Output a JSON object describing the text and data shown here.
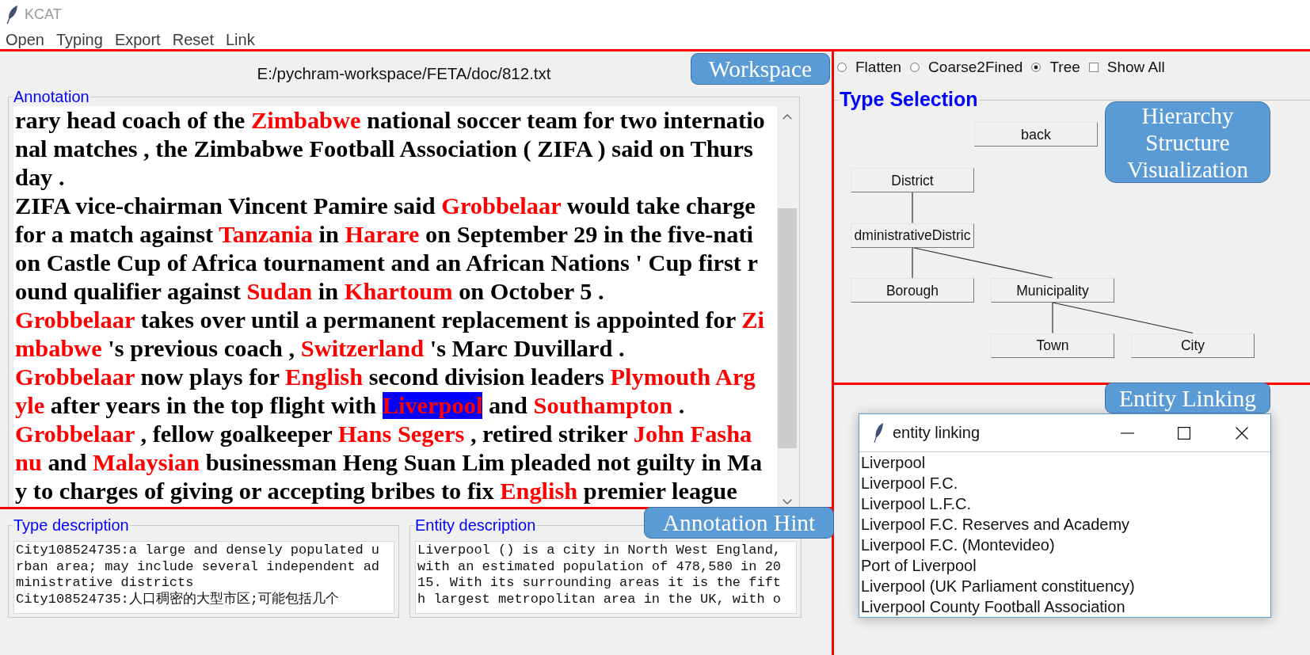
{
  "window": {
    "title": "KCAT"
  },
  "menu": [
    "Open",
    "Typing",
    "Export",
    "Reset",
    "Link"
  ],
  "workspace": {
    "callout": "Workspace",
    "file_path": "E:/pychram-workspace/FETA/doc/812.txt",
    "annotation": {
      "label": "Annotation",
      "lines": [
        {
          "segments": [
            {
              "text": "rary head coach of the ",
              "entity": false,
              "selected": false
            },
            {
              "text": "Zimbabwe",
              "entity": true,
              "selected": false
            },
            {
              "text": " national soccer team for two internatio",
              "entity": false,
              "selected": false
            }
          ]
        },
        {
          "segments": [
            {
              "text": "nal matches , the Zimbabwe Football Association ( ZIFA ) said on Thurs",
              "entity": false,
              "selected": false
            }
          ]
        },
        {
          "segments": [
            {
              "text": "day .",
              "entity": false,
              "selected": false
            }
          ]
        },
        {
          "segments": [
            {
              "text": "ZIFA vice-chairman Vincent Pamire said ",
              "entity": false,
              "selected": false
            },
            {
              "text": "Grobbelaar",
              "entity": true,
              "selected": false
            },
            {
              "text": " would take charge",
              "entity": false,
              "selected": false
            }
          ]
        },
        {
          "segments": [
            {
              "text": "for a match against ",
              "entity": false,
              "selected": false
            },
            {
              "text": "Tanzania",
              "entity": true,
              "selected": false
            },
            {
              "text": " in ",
              "entity": false,
              "selected": false
            },
            {
              "text": "Harare",
              "entity": true,
              "selected": false
            },
            {
              "text": " on September 29 in the five-nati",
              "entity": false,
              "selected": false
            }
          ]
        },
        {
          "segments": [
            {
              "text": "on Castle Cup of Africa tournament and an African Nations ' Cup first r",
              "entity": false,
              "selected": false
            }
          ]
        },
        {
          "segments": [
            {
              "text": "ound qualifier against ",
              "entity": false,
              "selected": false
            },
            {
              "text": "Sudan",
              "entity": true,
              "selected": false
            },
            {
              "text": " in ",
              "entity": false,
              "selected": false
            },
            {
              "text": "Khartoum",
              "entity": true,
              "selected": false
            },
            {
              "text": " on October 5 .",
              "entity": false,
              "selected": false
            }
          ]
        },
        {
          "segments": [
            {
              "text": "Grobbelaar",
              "entity": true,
              "selected": false
            },
            {
              "text": " takes over until a permanent replacement is appointed for ",
              "entity": false,
              "selected": false
            },
            {
              "text": "Zi",
              "entity": true,
              "selected": false
            }
          ]
        },
        {
          "segments": [
            {
              "text": "mbabwe",
              "entity": true,
              "selected": false
            },
            {
              "text": " 's previous coach , ",
              "entity": false,
              "selected": false
            },
            {
              "text": "Switzerland",
              "entity": true,
              "selected": false
            },
            {
              "text": " 's Marc Duvillard .",
              "entity": false,
              "selected": false
            }
          ]
        },
        {
          "segments": [
            {
              "text": "Grobbelaar",
              "entity": true,
              "selected": false
            },
            {
              "text": " now plays for ",
              "entity": false,
              "selected": false
            },
            {
              "text": "English",
              "entity": true,
              "selected": false
            },
            {
              "text": " second division leaders ",
              "entity": false,
              "selected": false
            },
            {
              "text": "Plymouth Arg",
              "entity": true,
              "selected": false
            }
          ]
        },
        {
          "segments": [
            {
              "text": "yle",
              "entity": true,
              "selected": false
            },
            {
              "text": " after years in the top flight with ",
              "entity": false,
              "selected": false
            },
            {
              "text": "Liverpool",
              "entity": true,
              "selected": true
            },
            {
              "text": " and ",
              "entity": false,
              "selected": false
            },
            {
              "text": "Southampton",
              "entity": true,
              "selected": false
            },
            {
              "text": " .",
              "entity": false,
              "selected": false
            }
          ]
        },
        {
          "segments": [
            {
              "text": "Grobbelaar",
              "entity": true,
              "selected": false
            },
            {
              "text": " , fellow goalkeeper ",
              "entity": false,
              "selected": false
            },
            {
              "text": "Hans Segers",
              "entity": true,
              "selected": false
            },
            {
              "text": " , retired striker ",
              "entity": false,
              "selected": false
            },
            {
              "text": "John Fasha",
              "entity": true,
              "selected": false
            }
          ]
        },
        {
          "segments": [
            {
              "text": "nu",
              "entity": true,
              "selected": false
            },
            {
              "text": " and ",
              "entity": false,
              "selected": false
            },
            {
              "text": "Malaysian",
              "entity": true,
              "selected": false
            },
            {
              "text": " businessman Heng Suan Lim pleaded not guilty in Ma",
              "entity": false,
              "selected": false
            }
          ]
        },
        {
          "segments": [
            {
              "text": "y to charges of giving or accepting bribes to fix ",
              "entity": false,
              "selected": false
            },
            {
              "text": "English",
              "entity": true,
              "selected": false
            },
            {
              "text": " premier league",
              "entity": false,
              "selected": false
            }
          ]
        }
      ]
    }
  },
  "annotation_hint": {
    "callout": "Annotation Hint",
    "type_description": {
      "label": "Type description",
      "lines": [
        "City108524735:a large and densely populated u",
        "rban area; may include several independent ad",
        "ministrative districts",
        "City108524735:人口稠密的大型市区;可能包括几个"
      ]
    },
    "entity_description": {
      "label": "Entity description",
      "lines": [
        "Liverpool () is a city in North West England,",
        "with an estimated population of 478,580 in 20",
        "15. With its surrounding areas it is the fift",
        "h largest metropolitan area in the UK, with o"
      ]
    }
  },
  "type_panel": {
    "options": [
      {
        "kind": "radio",
        "label": "Flatten",
        "selected": false
      },
      {
        "kind": "radio",
        "label": "Coarse2Fined",
        "selected": false
      },
      {
        "kind": "radio",
        "label": "Tree",
        "selected": true
      },
      {
        "kind": "checkbox",
        "label": "Show All",
        "checked": false
      }
    ],
    "type_selection": {
      "label": "Type Selection",
      "back_button": "back",
      "callout": "Hierarchy Structure Visualization",
      "tree": [
        {
          "label": "District",
          "children": [
            {
              "label": "dministrativeDistric",
              "children": [
                {
                  "label": "Borough"
                },
                {
                  "label": "Municipality",
                  "children": [
                    {
                      "label": "Town"
                    },
                    {
                      "label": "City"
                    }
                  ]
                }
              ]
            }
          ]
        }
      ]
    }
  },
  "entity_linking": {
    "callout": "Entity Linking",
    "window": {
      "title": "entity linking",
      "candidates": [
        {
          "label": "Liverpool",
          "selected": false
        },
        {
          "label": "Liverpool F.C.",
          "selected": false
        },
        {
          "label": "Liverpool L.F.C.",
          "selected": false
        },
        {
          "label": "Liverpool F.C. Reserves and Academy",
          "selected": false
        },
        {
          "label": "Liverpool F.C. (Montevideo)",
          "selected": false
        },
        {
          "label": "Port of Liverpool",
          "selected": false
        },
        {
          "label": "Liverpool (UK Parliament constituency)",
          "selected": false
        },
        {
          "label": "Liverpool County Football Association",
          "selected": false
        }
      ]
    }
  }
}
